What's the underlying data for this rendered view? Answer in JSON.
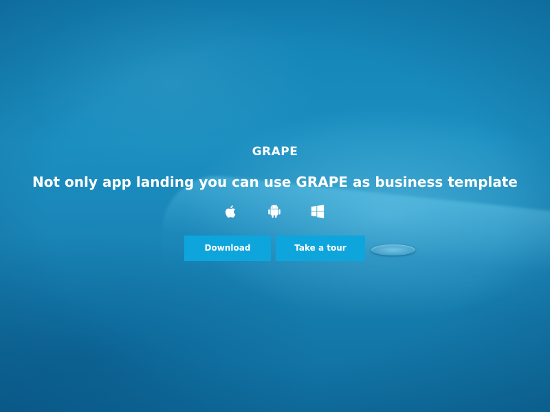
{
  "hero": {
    "brand": "GRAPE",
    "headline": "Not only app landing you can use GRAPE as business template",
    "platform_icons": [
      "apple-icon",
      "android-icon",
      "windows-icon"
    ],
    "buttons": {
      "download_label": "Download",
      "tour_label": "Take a tour"
    }
  },
  "colors": {
    "background": "#1a86b8",
    "button": "#0ea5dc",
    "text": "#ffffff"
  }
}
